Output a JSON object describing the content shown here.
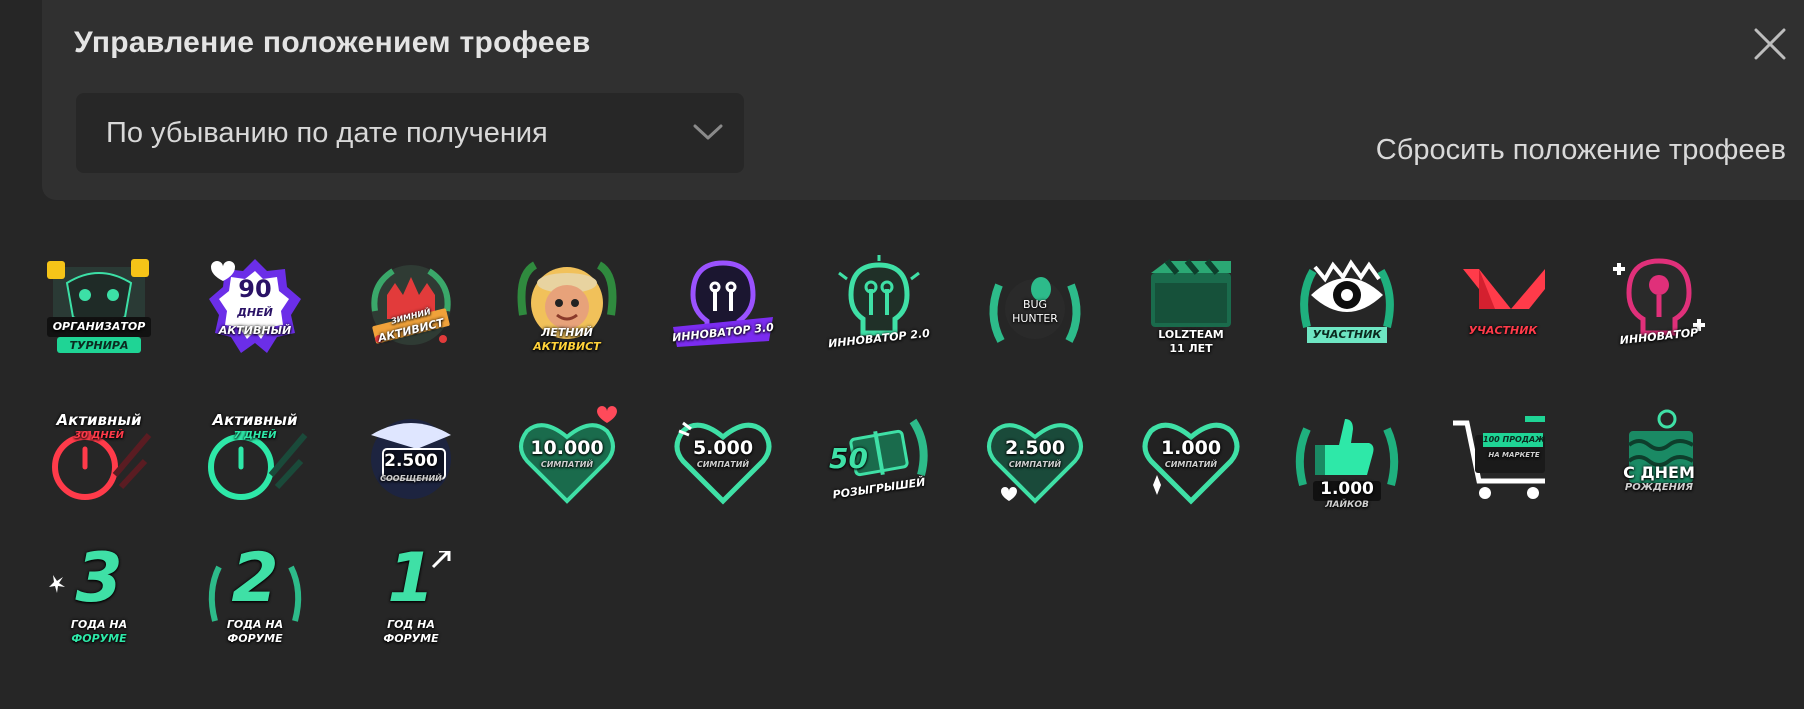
{
  "dialog": {
    "title": "Управление положением трофеев",
    "sort_value": "По убыванию по дате получения",
    "reset_label": "Сбросить положение трофеев"
  },
  "trophies": [
    {
      "name": "organizer",
      "lines": [
        "ОРГАНИЗАТОР",
        "ТУРНИРА"
      ]
    },
    {
      "name": "90-days",
      "lines": [
        "90",
        "ДНЕЙ",
        "АКТИВНЫЙ"
      ]
    },
    {
      "name": "winter",
      "lines": [
        "ЗИМНИЙ",
        "АКТИВИСТ"
      ]
    },
    {
      "name": "summer",
      "lines": [
        "ЛЕТНИЙ",
        "АКТИВИСТ"
      ]
    },
    {
      "name": "innovator-3",
      "lines": [
        "ИННОВАТОР 3.0"
      ]
    },
    {
      "name": "innovator-2",
      "lines": [
        "ИННОВАТОР 2.0"
      ]
    },
    {
      "name": "bug-hunter",
      "lines": [
        "BUG",
        "HUNTER"
      ]
    },
    {
      "name": "lolzteam-11",
      "lines": [
        "LOLZTEAM",
        "11 ЛЕТ"
      ]
    },
    {
      "name": "participant-green",
      "lines": [
        "УЧАСТНИК"
      ]
    },
    {
      "name": "participant-red",
      "lines": [
        "УЧАСТНИК"
      ]
    },
    {
      "name": "innovator-pink",
      "lines": [
        "ИННОВАТОР"
      ]
    },
    {
      "name": "active-30",
      "lines": [
        "Активный",
        "30 ДНЕЙ"
      ]
    },
    {
      "name": "active-7",
      "lines": [
        "Активный",
        "7 ДНЕЙ"
      ]
    },
    {
      "name": "messages-2500",
      "lines": [
        "2.500",
        "СООБЩЕНИЙ"
      ]
    },
    {
      "name": "likes-10000",
      "lines": [
        "10.000",
        "СИМПАТИЙ"
      ]
    },
    {
      "name": "likes-5000",
      "lines": [
        "5.000",
        "СИМПАТИЙ"
      ]
    },
    {
      "name": "giveaways-50",
      "lines": [
        "50",
        "РОЗЫГРЫШЕЙ"
      ]
    },
    {
      "name": "likes-2500",
      "lines": [
        "2.500",
        "СИМПАТИЙ"
      ]
    },
    {
      "name": "likes-1000",
      "lines": [
        "1.000",
        "СИМПАТИЙ"
      ]
    },
    {
      "name": "thumbs-1000",
      "lines": [
        "1.000",
        "ЛАЙКОВ"
      ]
    },
    {
      "name": "sales-100",
      "lines": [
        "100 ПРОДАЖ",
        "НА МАРКЕТЕ"
      ]
    },
    {
      "name": "birthday",
      "lines": [
        "С ДНЕМ",
        "РОЖДЕНИЯ"
      ]
    },
    {
      "name": "years-3",
      "lines": [
        "3",
        "ГОДА НА",
        "ФОРУМЕ"
      ]
    },
    {
      "name": "years-2",
      "lines": [
        "2",
        "ГОДА НА",
        "ФОРУМЕ"
      ]
    },
    {
      "name": "years-1",
      "lines": [
        "1",
        "ГОД НА",
        "ФОРУМЕ"
      ]
    }
  ],
  "icons": {
    "close": "close-icon",
    "chevron": "chevron-down-icon"
  },
  "colors": {
    "background": "#262626",
    "panel": "#303030",
    "accent_green": "#2ee8a8",
    "accent_purple": "#7b2cf0",
    "accent_red": "#ff3b4a",
    "accent_pink": "#e0307a"
  }
}
